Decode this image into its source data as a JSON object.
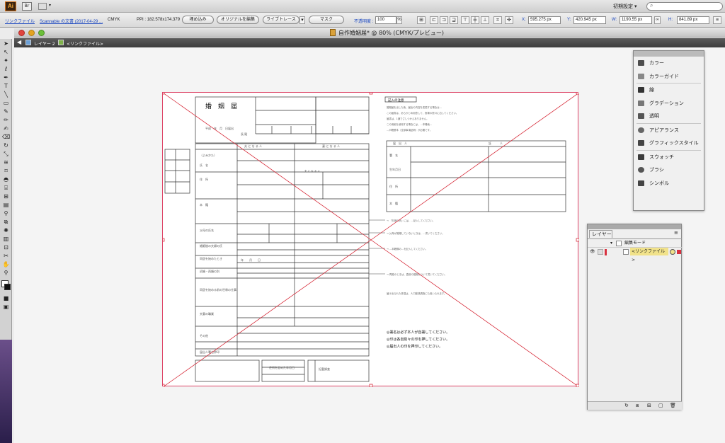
{
  "app": {
    "logo": "Ai",
    "bridge": "Br",
    "workspace": "初期設定 ▾",
    "search_placeholder": ""
  },
  "control": {
    "link_file": "リンクファイル",
    "file_name": "Scannable の文書 (2017-04-29 ...",
    "color_mode": "CMYK",
    "ppi": "PPI : 182.578x174.379",
    "embed": "埋め込み",
    "edit_original": "オリジナルを編集",
    "live_trace": "ライブトレース",
    "mask": "マスク",
    "opacity_label": "不透明度 :",
    "opacity_value": "100",
    "opacity_unit": "%",
    "x_label": "X:",
    "x_value": "595.275 px",
    "y_label": "Y:",
    "y_value": "420.945 px",
    "w_label": "W:",
    "w_value": "1190.55 px",
    "h_label": "H:",
    "h_value": "841.89 px"
  },
  "window": {
    "title": "自作婚姻届* @ 80% (CMYK/プレビュー)"
  },
  "breadcrumb": {
    "layer": "レイヤー 2",
    "item": "<リンクファイル>"
  },
  "panels": [
    {
      "label": "カラー",
      "icon": "color-icon"
    },
    {
      "label": "カラーガイド",
      "icon": "color-guide-icon"
    },
    {
      "label": "線",
      "icon": "stroke-icon"
    },
    {
      "label": "グラデーション",
      "icon": "gradient-icon"
    },
    {
      "label": "透明",
      "icon": "transparency-icon"
    },
    {
      "label": "アピアランス",
      "icon": "appearance-icon"
    },
    {
      "label": "グラフィックスタイル",
      "icon": "graphic-style-icon"
    },
    {
      "label": "スウォッチ",
      "icon": "swatches-icon"
    },
    {
      "label": "ブラシ",
      "icon": "brushes-icon"
    },
    {
      "label": "シンボル",
      "icon": "symbols-icon"
    }
  ],
  "layers": {
    "tab": "レイヤー",
    "layer_name": "編集モード",
    "item_name": "<リンクファイル>"
  },
  "form": {
    "title": "婚　姻　届",
    "notes_title": "記入の注意",
    "bullet1": "◎署名は必ず本人が自署してください。",
    "bullet2": "◎印は各自別々の印を押してください。",
    "bullet3": "◎届出人の印を押印してください。"
  },
  "colors": {
    "accent": "#d8313f",
    "ai_orange": "#ffb03a"
  }
}
